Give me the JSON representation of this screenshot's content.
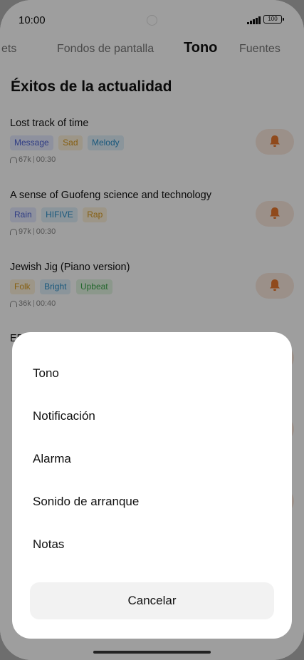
{
  "status_bar": {
    "time": "10:00",
    "battery": "100"
  },
  "tabs": [
    {
      "label": "ets"
    },
    {
      "label": "Fondos de pantalla"
    },
    {
      "label": "Tono"
    },
    {
      "label": "Fuentes"
    }
  ],
  "section": {
    "title": "Éxitos de la actualidad"
  },
  "songs": [
    {
      "title": "Lost track of time",
      "tags": [
        "Message",
        "Sad",
        "Melody"
      ],
      "plays": "67k",
      "duration": "00:30"
    },
    {
      "title": "A sense of Guofeng science and technology",
      "tags": [
        "Rain",
        "HIFIVE",
        "Rap"
      ],
      "plays": "97k",
      "duration": "00:30"
    },
    {
      "title": "Jewish Jig (Piano version)",
      "tags": [
        "Folk",
        "Bright",
        "Upbeat"
      ],
      "plays": "36k",
      "duration": "00:40"
    }
  ],
  "partial_rows": {
    "row4_prefix": "ED"
  },
  "sheet": {
    "options": [
      "Tono",
      "Notificación",
      "Alarma",
      "Sonido de arranque",
      "Notas"
    ],
    "cancel_label": "Cancelar"
  },
  "colors": {
    "accent_orange": "#e8782e",
    "tag_blue_bg": "#e6eaff",
    "tag_blue_fg": "#4d63d6",
    "tag_yellow_bg": "#fdf3dc",
    "tag_yellow_fg": "#d99a1e",
    "tag_cyan_bg": "#e0f1fb",
    "tag_cyan_fg": "#2a8fc9",
    "tag_green_bg": "#e3f6e3",
    "tag_green_fg": "#3aa64a"
  }
}
